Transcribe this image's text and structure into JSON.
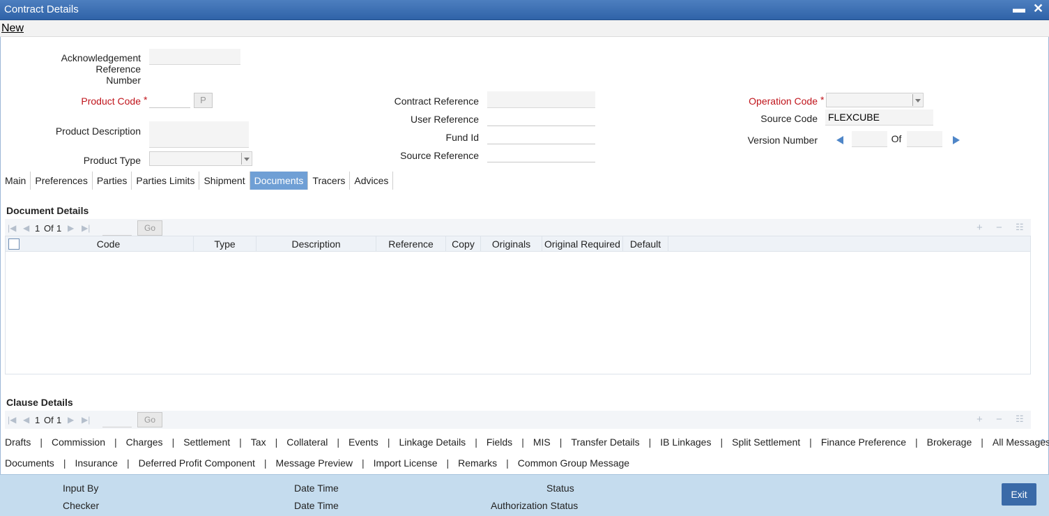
{
  "window": {
    "title": "Contract Details",
    "minimize": "▬",
    "close": "✕"
  },
  "menu": {
    "new_label": "New"
  },
  "header": {
    "ack_ref_label_1": "Acknowledgement Reference",
    "ack_ref_label_2": "Number",
    "product_code_label": "Product Code",
    "product_code_button": "P",
    "product_description_label": "Product Description",
    "product_type_label": "Product Type",
    "contract_reference_label": "Contract Reference",
    "user_reference_label": "User Reference",
    "fund_id_label": "Fund Id",
    "source_reference_label": "Source Reference",
    "operation_code_label": "Operation Code",
    "source_code_label": "Source Code",
    "source_code_value": "FLEXCUBE",
    "version_number_label": "Version Number",
    "version_of": "Of",
    "required_mark": "*"
  },
  "tabs": [
    {
      "label": "Main"
    },
    {
      "label": "Preferences"
    },
    {
      "label": "Parties"
    },
    {
      "label": "Parties Limits"
    },
    {
      "label": "Shipment"
    },
    {
      "label": "Documents",
      "active": true
    },
    {
      "label": "Tracers"
    },
    {
      "label": "Advices"
    }
  ],
  "documents": {
    "section_title": "Document Details",
    "pager_current": "1",
    "pager_of": "Of",
    "pager_total": "1",
    "go_label": "Go",
    "columns": [
      "Code",
      "Type",
      "Description",
      "Reference",
      "Copy",
      "Originals",
      "Original Required",
      "Default"
    ]
  },
  "clauses": {
    "section_title": "Clause Details",
    "pager_current": "1",
    "pager_of": "Of",
    "pager_total": "1",
    "go_label": "Go"
  },
  "links_row1": [
    "Drafts",
    "Commission",
    "Charges",
    "Settlement",
    "Tax",
    "Collateral",
    "Events",
    "Linkage Details",
    "Fields",
    "MIS",
    "Transfer Details",
    "IB Linkages",
    "Split Settlement",
    "Finance Preference",
    "Brokerage",
    "All Messages"
  ],
  "links_row2": [
    "Documents",
    "Insurance",
    "Deferred Profit Component",
    "Message Preview",
    "Import License",
    "Remarks",
    "Common Group Message"
  ],
  "footer": {
    "input_by": "Input By",
    "checker": "Checker",
    "date_time_1": "Date Time",
    "date_time_2": "Date Time",
    "status": "Status",
    "authorization_status": "Authorization Status",
    "exit_label": "Exit"
  }
}
